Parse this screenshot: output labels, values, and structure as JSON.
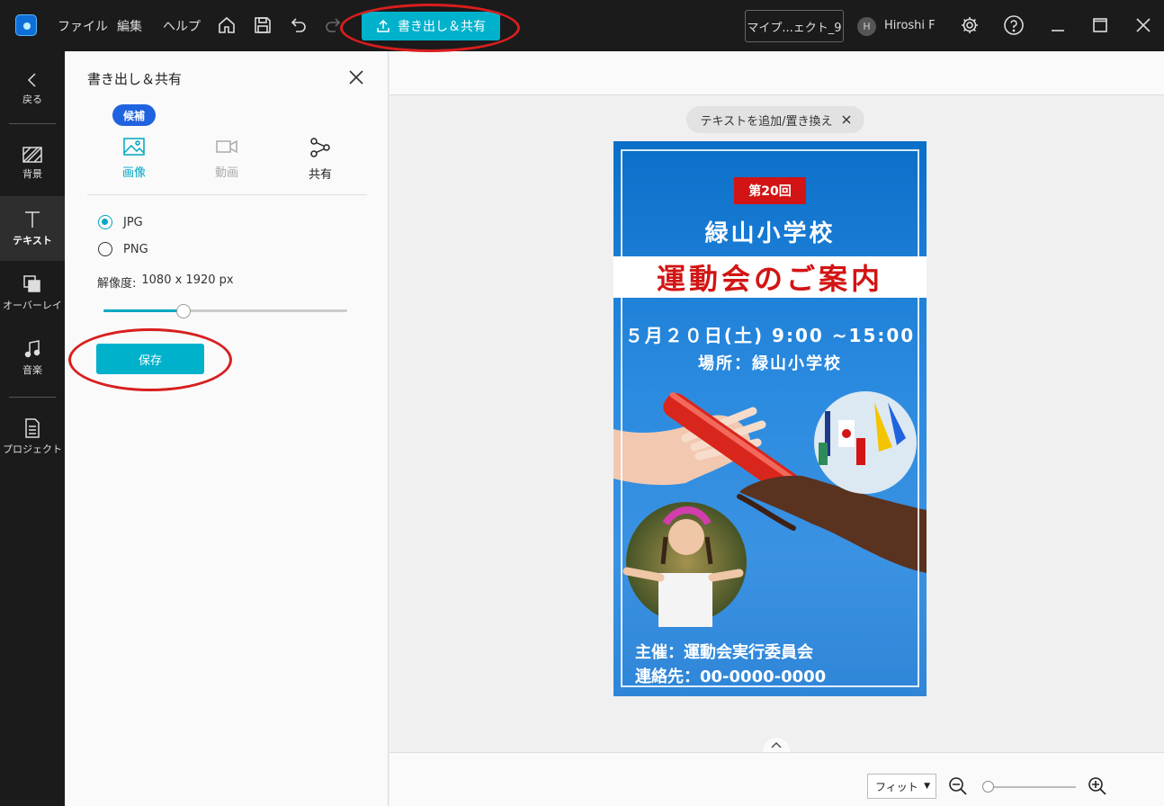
{
  "menu": {
    "file": "ファイル",
    "edit": "編集",
    "help": "ヘルプ"
  },
  "toolbar": {
    "export_label": "書き出し＆共有"
  },
  "project": {
    "name": "マイプ...ェクト_9"
  },
  "user": {
    "initial": "H",
    "name": "Hiroshi F"
  },
  "rail": {
    "back": "戻る",
    "items": [
      {
        "label": "背景"
      },
      {
        "label": "テキスト"
      },
      {
        "label": "オーバーレイ"
      },
      {
        "label": "音楽"
      },
      {
        "label": "プロジェクト"
      }
    ]
  },
  "panel": {
    "title": "書き出し＆共有",
    "badge": "候補",
    "tabs": [
      {
        "label": "画像"
      },
      {
        "label": "動画"
      },
      {
        "label": "共有"
      }
    ],
    "formats": [
      {
        "label": "JPG",
        "selected": true
      },
      {
        "label": "PNG",
        "selected": false
      }
    ],
    "resolution_label": "解像度:",
    "resolution_value": "1080 x 1920 px",
    "quality_fraction": 0.33,
    "save_label": "保存"
  },
  "canvas": {
    "chip_label": "テキストを追加/置き換え",
    "zoom_mode": "フィット",
    "zoom_fraction": 0.05
  },
  "poster": {
    "edition": "第20回",
    "school": "緑山小学校",
    "headline": "運動会のご案内",
    "date_time": "５月２０日(土)  9:00 ~15:00",
    "place": "場所：緑山小学校",
    "host": "主催：運動会実行委員会",
    "contact": "連絡先：00-0000-0000"
  },
  "colors": {
    "accent": "#00b1cc",
    "badge_blue": "#1f63e0",
    "poster_red": "#d21414",
    "annotation": "#d81e1e"
  }
}
